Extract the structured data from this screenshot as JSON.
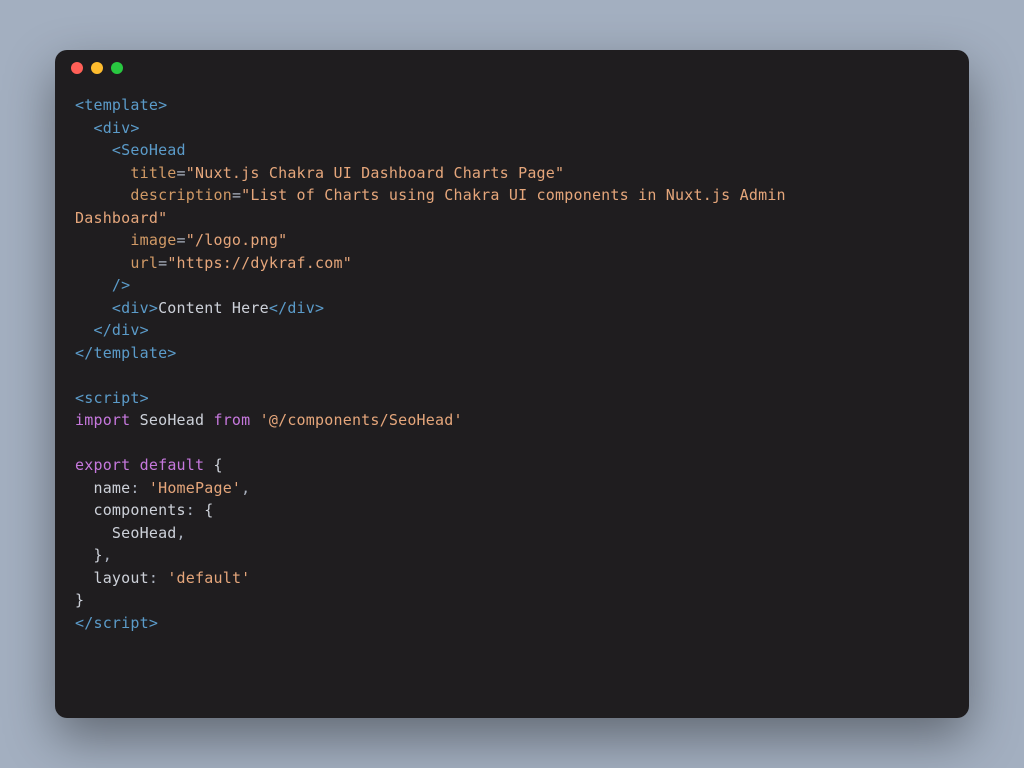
{
  "code": {
    "line1_open_template": "<template>",
    "line2_open_div": "  <div>",
    "line3_seohead": "    <SeoHead",
    "line4_attr_title": "      title",
    "line4_eq": "=",
    "line4_val": "\"Nuxt.js Chakra UI Dashboard Charts Page\"",
    "line5_attr_desc": "      description",
    "line5_eq": "=",
    "line5_val_a": "\"List of Charts using Chakra UI components in Nuxt.js Admin ",
    "line6_val_b": "Dashboard\"",
    "line7_attr_image": "      image",
    "line7_eq": "=",
    "line7_val": "\"/logo.png\"",
    "line8_attr_url": "      url",
    "line8_eq": "=",
    "line8_val": "\"https://dykraf.com\"",
    "line9_close": "    />",
    "line10_open_div": "    <div>",
    "line10_content": "Content Here",
    "line10_close_div": "</div>",
    "line11_close_div": "  </div>",
    "line12_close_template": "</template>",
    "blank1": "",
    "line13_open_script": "<script>",
    "line14_import": "import",
    "line14_name": " SeoHead ",
    "line14_from": "from",
    "line14_path": " '@/components/SeoHead'",
    "blank2": "",
    "line15_export": "export",
    "line15_default": " default",
    "line15_brace": " {",
    "line16_name_key": "  name",
    "line16_colon": ": ",
    "line16_val": "'HomePage'",
    "line16_comma": ",",
    "line17_components": "  components",
    "line17_colon": ": ",
    "line17_brace": "{",
    "line18_seohead": "    SeoHead",
    "line18_comma": ",",
    "line19_close": "  }",
    "line19_comma": ",",
    "line20_layout": "  layout",
    "line20_colon": ": ",
    "line20_val": "'default'",
    "line21_close": "}",
    "line22_close_script": "</script>"
  }
}
